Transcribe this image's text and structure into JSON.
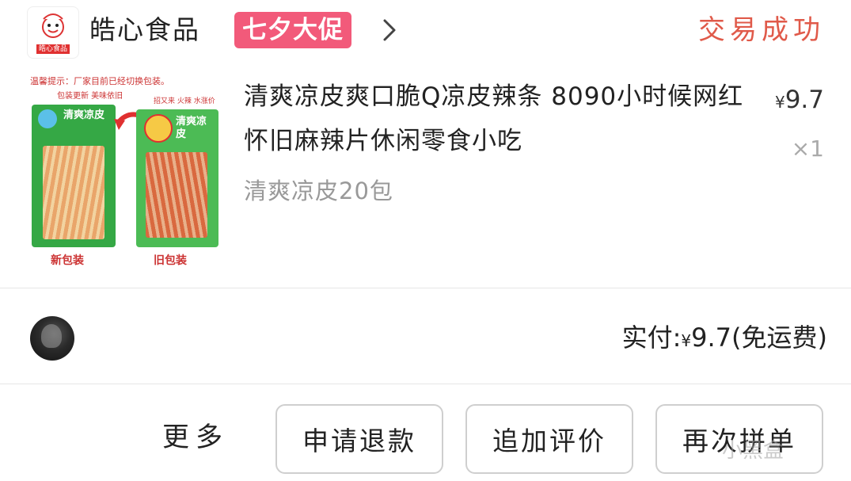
{
  "store": {
    "name": "皓心食品",
    "promo_badge": "七夕大促",
    "logo_text": "皓心食品"
  },
  "order": {
    "status": "交易成功"
  },
  "product": {
    "title": "清爽凉皮爽口脆Q凉皮辣条 8090小时候网红怀旧麻辣片休闲零食小吃",
    "price_symbol": "¥",
    "price": "9.7",
    "quantity": "×1",
    "variant": "清爽凉皮20包",
    "image_texts": {
      "notice": "温馨提示：厂家目前已经切换包装。",
      "new_tagline": "包装更新 美味依旧",
      "old_tagline": "招又来 火辣 水涨价",
      "new_label": "新包装",
      "old_label": "旧包装",
      "brand": "清爽凉皮"
    }
  },
  "payment": {
    "label": "实付:",
    "symbol": "¥",
    "amount": "9.7",
    "shipping_note": "(免运费)"
  },
  "actions": {
    "more": "更多",
    "refund": "申请退款",
    "review": "追加评价",
    "regroup": "再次拼单"
  },
  "watermark": "小黑盒",
  "colors": {
    "promo": "#f25a7a",
    "status": "#e05a4a",
    "package_green": "#35a845"
  }
}
